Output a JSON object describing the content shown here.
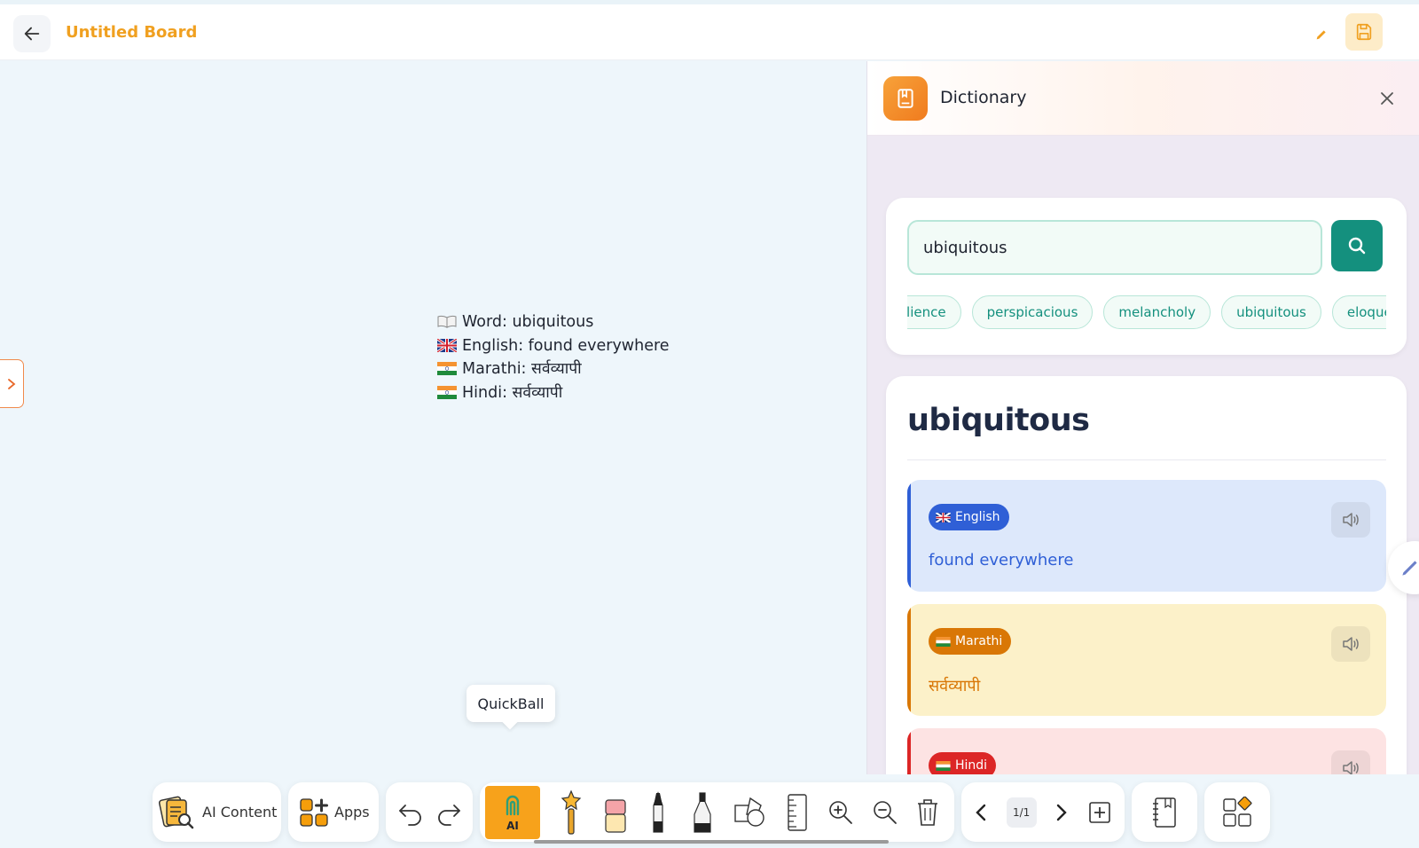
{
  "header": {
    "title": "Untitled Board"
  },
  "board": {
    "lines": [
      {
        "flag": "book",
        "text": "Word: ubiquitous"
      },
      {
        "flag": "uk",
        "text": "English: found everywhere"
      },
      {
        "flag": "india",
        "text": "Marathi: सर्वव्यापी"
      },
      {
        "flag": "india",
        "text": "Hindi: सर्वव्यापी"
      }
    ],
    "tooltip": "QuickBall"
  },
  "panel": {
    "title": "Dictionary",
    "search": {
      "value": "ubiquitous"
    },
    "recent_chips": [
      "resilience",
      "perspicacious",
      "melancholy",
      "ubiquitous",
      "eloquent"
    ],
    "result": {
      "word": "ubiquitous",
      "languages": [
        {
          "name": "English",
          "meaning": "found everywhere",
          "badge_color": "#2f5fd6",
          "bg": "#dde8fb",
          "bar": "#2f5fd6",
          "text_color": "#2f5fd6"
        },
        {
          "name": "Marathi",
          "meaning": "सर्वव्यापी",
          "badge_color": "#d97706",
          "bg": "#fcf1c9",
          "bar": "#d97706",
          "text_color": "#d97706"
        },
        {
          "name": "Hindi",
          "meaning": "",
          "badge_color": "#dc2626",
          "bg": "#fde3e3",
          "bar": "#dc2626",
          "text_color": "#dc2626"
        }
      ]
    }
  },
  "toolbar": {
    "ai_content_label": "AI Content",
    "apps_label": "Apps",
    "ai_label": "AI",
    "page_indicator": "1/1"
  },
  "colors": {
    "accent_orange": "#f0a020",
    "teal": "#14907e",
    "canvas_bg": "#eef6fb"
  }
}
